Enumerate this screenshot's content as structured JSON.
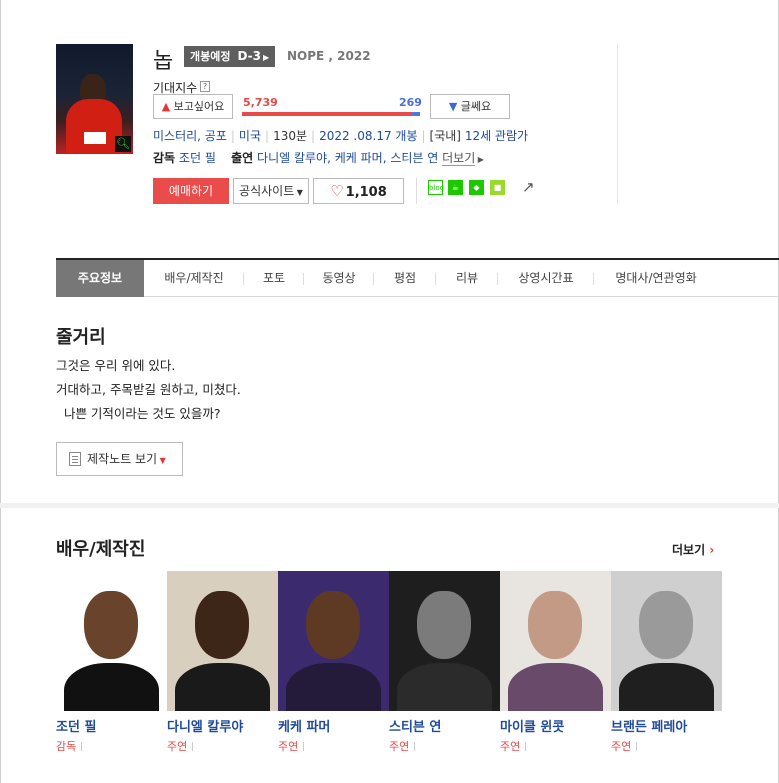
{
  "movie": {
    "title": "놉",
    "release_badge": "개봉예정",
    "dday": "D-3",
    "original_title": "NOPE , 2022",
    "expectation_label": "기대지수",
    "want_label": "보고싶어요",
    "nope_label": "글쎄요",
    "want_count": "5,739",
    "nope_count": "269",
    "want_ratio": 0.955,
    "genres": "미스터리, 공포",
    "country": "미국",
    "runtime": "130분",
    "release_date": "2022 .08.17 개봉",
    "rating_prefix": "[국내]",
    "rating": "12세 관람가",
    "director_label": "감독",
    "director": "조던 필",
    "cast_label": "출연",
    "cast_names": "다니엘 칼루야, 케케 파머, 스티븐 연",
    "more_label": "더보기",
    "book_label": "예매하기",
    "site_label": "공식사이트",
    "like_count": "1,108"
  },
  "share": {
    "blog_label": "blog"
  },
  "tabs": [
    "주요정보",
    "배우/제작진",
    "포토",
    "동영상",
    "평점",
    "리뷰",
    "상영시간표",
    "명대사/연관영화"
  ],
  "synopsis": {
    "title": "줄거리",
    "lines": [
      "그것은 우리 위에 있다.",
      "거대하고, 주목받길 원하고, 미쳤다.",
      "  나쁜 기적이라는 것도 있을까?"
    ],
    "notes_label": "제작노트 보기"
  },
  "cast_section": {
    "title": "배우/제작진",
    "more_label": "더보기",
    "people": [
      {
        "name": "조던 필",
        "role": "감독",
        "bg": "#ffffff",
        "skin": "#6a432c",
        "clothes": "#111111"
      },
      {
        "name": "다니엘 칼루야",
        "role": "주연",
        "bg": "#d9cfbf",
        "skin": "#3d2518",
        "clothes": "#1a1a1a"
      },
      {
        "name": "케케 파머",
        "role": "주연",
        "bg": "#3c2a6e",
        "skin": "#5e3a24",
        "clothes": "#241a3a"
      },
      {
        "name": "스티븐 연",
        "role": "주연",
        "bg": "#1e1e1e",
        "skin": "#7b7b7b",
        "clothes": "#2b2b2b"
      },
      {
        "name": "마이클 윈콧",
        "role": "주연",
        "bg": "#e8e4e0",
        "skin": "#c29a86",
        "clothes": "#6a4a6a"
      },
      {
        "name": "브랜든 페레아",
        "role": "주연",
        "bg": "#cfcfcf",
        "skin": "#9a9a9a",
        "clothes": "#1f1f1f"
      }
    ]
  }
}
